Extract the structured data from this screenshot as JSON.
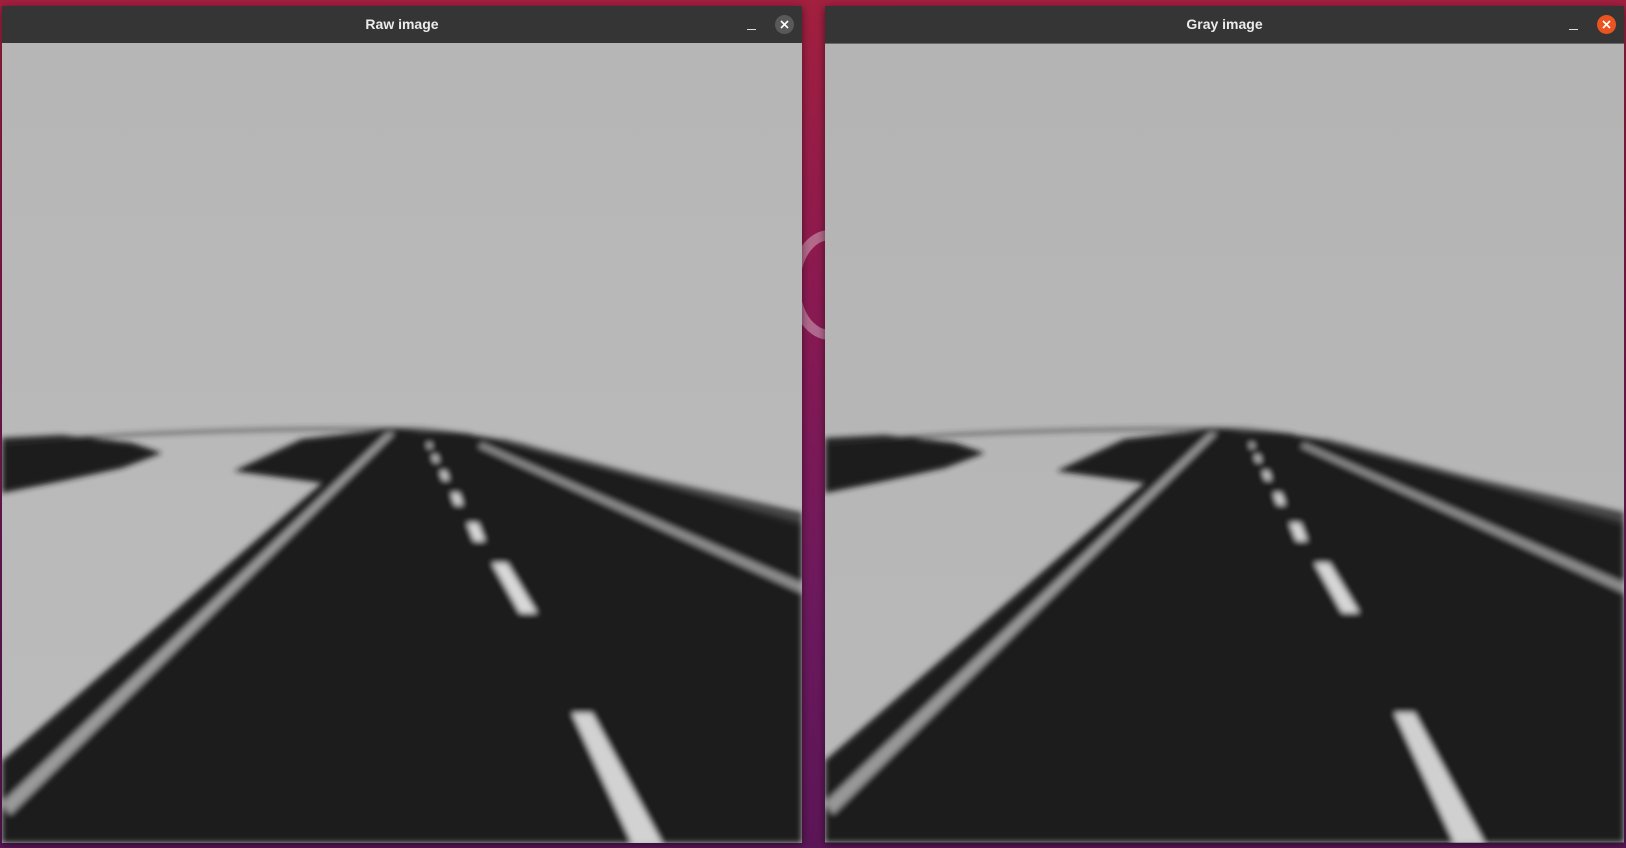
{
  "desktop": {
    "wallpaper_colors": [
      "#a3203f",
      "#8b1a52",
      "#6e1a5e",
      "#5c1657"
    ]
  },
  "windows": [
    {
      "title": "Raw image",
      "minimize_icon": "minimize-icon",
      "close_icon": "close-icon",
      "close_color": "#595959",
      "image": "road-camera-frame"
    },
    {
      "title": "Gray image",
      "minimize_icon": "minimize-icon",
      "close_icon": "close-icon",
      "close_color": "#e95420",
      "image": "road-camera-frame-grayscale"
    }
  ]
}
